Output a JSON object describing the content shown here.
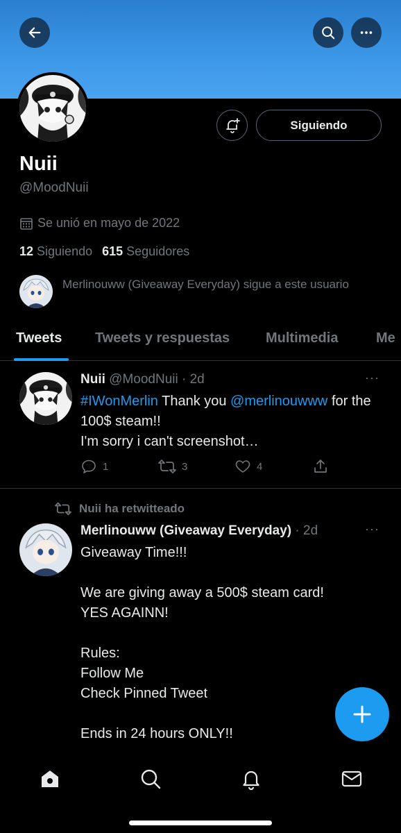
{
  "header": {
    "back_icon": "arrow-left-icon",
    "search_icon": "search-icon",
    "more_icon": "more-horizontal-icon",
    "banner_color": "#3d98e8"
  },
  "profile": {
    "name": "Nuii",
    "handle": "@MoodNuii",
    "joined": "Se unió en mayo de 2022",
    "following_count": "12",
    "following_label": "Siguiendo",
    "followers_count": "615",
    "followers_label": "Seguidores",
    "follow_button_label": "Siguiendo",
    "followed_by_text": "Merlinouww (Giveaway Everyday) sigue a este usuario"
  },
  "tabs": [
    {
      "label": "Tweets",
      "active": true
    },
    {
      "label": "Tweets y respuestas",
      "active": false
    },
    {
      "label": "Multimedia",
      "active": false
    },
    {
      "label": "Me",
      "active": false
    }
  ],
  "tweets": [
    {
      "author_name": "Nuii",
      "author_handle": "@MoodNuii",
      "separator": "·",
      "time": "2d",
      "more": "···",
      "hashtag": "#IWonMerlin",
      "text_a": " Thank you ",
      "mention": "@merlinouwww",
      "text_b": " for the 100$ steam!!",
      "line2": "I'm sorry i can't screenshot…",
      "replies": "1",
      "retweets": "3",
      "likes": "4"
    },
    {
      "retweeted_by": "Nuii ha retwitteado",
      "author_name": "Merlinouww (Giveaway Everyday)",
      "separator": "·",
      "time": "2d",
      "more": "···",
      "lines": [
        "Giveaway Time!!!",
        "",
        "We are giving away a 500$ steam card!",
        "YES AGAINN!",
        "",
        "Rules:",
        "Follow Me",
        "Check Pinned Tweet",
        "",
        "Ends in 24 hours ONLY!!"
      ]
    }
  ],
  "colors": {
    "accent": "#1d9bf0",
    "muted": "#71767b",
    "text": "#e7e9ea",
    "divider": "#2f3336"
  },
  "bottom_nav": [
    "home-icon",
    "search-icon",
    "notifications-icon",
    "messages-icon"
  ],
  "fab_icon": "plus-icon"
}
